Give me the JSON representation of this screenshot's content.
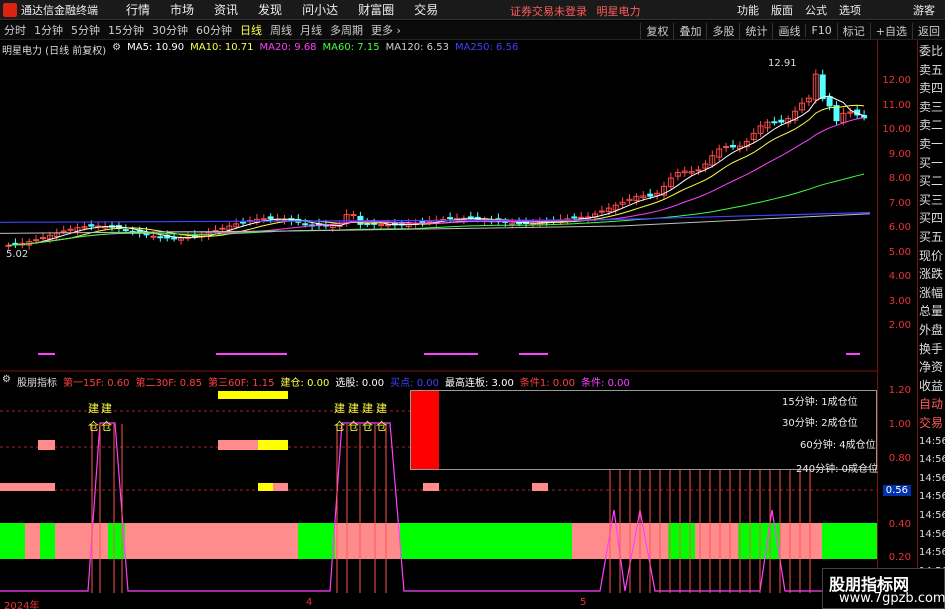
{
  "titlebar": {
    "app_name": "通达信金融终端",
    "menus": [
      "行情",
      "市场",
      "资讯",
      "发现",
      "问小达",
      "财富圈",
      "交易"
    ],
    "notice": "证券交易未登录",
    "stock": "明星电力",
    "right_items": [
      "功能",
      "版面",
      "公式",
      "选项"
    ],
    "guest": "游客"
  },
  "periodbar": {
    "periods": [
      "分时",
      "1分钟",
      "5分钟",
      "15分钟",
      "30分钟",
      "60分钟",
      "日线",
      "周线",
      "月线",
      "多周期",
      "更多 ›"
    ],
    "active": "日线",
    "right_items": [
      "复权",
      "叠加",
      "多股",
      "统计",
      "画线",
      "F10",
      "标记",
      "+自选",
      "返回"
    ]
  },
  "main_header": {
    "stock_title": "明星电力 (日线 前复权)",
    "ma": [
      {
        "label": "MA5: 10.90",
        "color": "#ffffff"
      },
      {
        "label": "MA10: 10.71",
        "color": "#ffff40"
      },
      {
        "label": "MA20: 9.68",
        "color": "#ff40ff"
      },
      {
        "label": "MA60: 7.15",
        "color": "#40ff40"
      },
      {
        "label": "MA120: 6.53",
        "color": "#d0d0d0"
      },
      {
        "label": "MA250: 6.56",
        "color": "#4040ff"
      }
    ]
  },
  "price_axis": [
    "12.00",
    "11.00",
    "10.00",
    "9.00",
    "8.00",
    "7.00",
    "6.00",
    "5.00",
    "4.00",
    "3.00",
    "2.00"
  ],
  "annotations": {
    "high": "12.91",
    "low": "5.02"
  },
  "sub_header": {
    "name": "股朋指标",
    "items": [
      {
        "label": "第一15F: 0.60",
        "color": "#ff4040"
      },
      {
        "label": "第二30F: 0.85",
        "color": "#ff4040"
      },
      {
        "label": "第三60F: 1.15",
        "color": "#ff4040"
      },
      {
        "label": "建仓: 0.00",
        "color": "#ffff40"
      },
      {
        "label": "选股: 0.00",
        "color": "#ffffff"
      },
      {
        "label": "买点: 0.00",
        "color": "#4040ff"
      },
      {
        "label": "最高连板: 3.00",
        "color": "#ffffff"
      },
      {
        "label": "条件1: 0.00",
        "color": "#ff4040"
      },
      {
        "label": "条件: 0.00",
        "color": "#ff40ff"
      }
    ]
  },
  "sub_axis": [
    "1.20",
    "1.00",
    "0.80",
    "0.56",
    "0.40",
    "0.20"
  ],
  "notice_box": {
    "lines": [
      "15分钟: 1成仓位",
      "30分钟: 2成仓位",
      "60分钟: 4成仓位",
      "240分钟: 0成仓位"
    ]
  },
  "right_panel": [
    "委比",
    "卖五",
    "卖四",
    "卖三",
    "卖二",
    "卖一",
    "买一",
    "买二",
    "买三",
    "买四",
    "买五",
    "现价",
    "涨跌",
    "涨幅",
    "总量",
    "外盘",
    "换手",
    "净资",
    "收益",
    "自动",
    "交易",
    "14:56",
    "14:56",
    "14:56",
    "14:56",
    "14:56",
    "14:56",
    "14:56",
    "14:56"
  ],
  "x_axis": [
    "2024年",
    "4",
    "5"
  ],
  "markers": {
    "jian": "建",
    "cang": "仓"
  },
  "watermark": {
    "title": "股朋指标网",
    "url": "www.7gpzb.com"
  }
}
